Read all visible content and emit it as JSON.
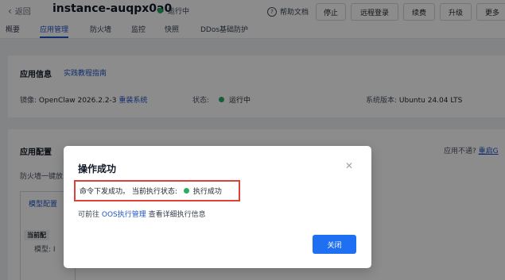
{
  "header": {
    "back_label": "返回",
    "instance_name": "instance-auqpx0a0",
    "status": "运行中",
    "help_label": "帮助文档",
    "buttons": [
      "停止",
      "远程登录",
      "续费",
      "升级",
      "更多"
    ]
  },
  "tabs": [
    "概要",
    "应用管理",
    "防火墙",
    "监控",
    "快照",
    "DDos基础防护"
  ],
  "active_tab": "应用管理",
  "app_info": {
    "title": "应用信息",
    "guide_link": "实践教程指南",
    "image_label": "镜像:",
    "image_value": "OpenClaw 2026.2.2-3",
    "reinstall_link": "重装系统",
    "state_label": "状态:",
    "state_value": "运行中",
    "os_label": "系统版本:",
    "os_value": "Ubuntu 24.04 LTS"
  },
  "app_config": {
    "title": "应用配置",
    "help_text": "应用不通?",
    "help_link": "重启G",
    "firewall_text": "防火墙一键放",
    "model_tab": "模型配置",
    "current_badge": "当前配",
    "model_label": "模型: I"
  },
  "modal": {
    "title": "操作成功",
    "message_prefix": "命令下发成功。 当前执行状态:",
    "exec_status": "执行成功",
    "sub_before": "可前往 ",
    "sub_link": "OOS执行管理",
    "sub_after": " 查看详细执行信息",
    "close_button": "关闭"
  },
  "colors": {
    "accent": "#1e55c8",
    "primary_button": "#1e6ff1",
    "success": "#27ae60",
    "highlight_border": "#e0403a"
  }
}
